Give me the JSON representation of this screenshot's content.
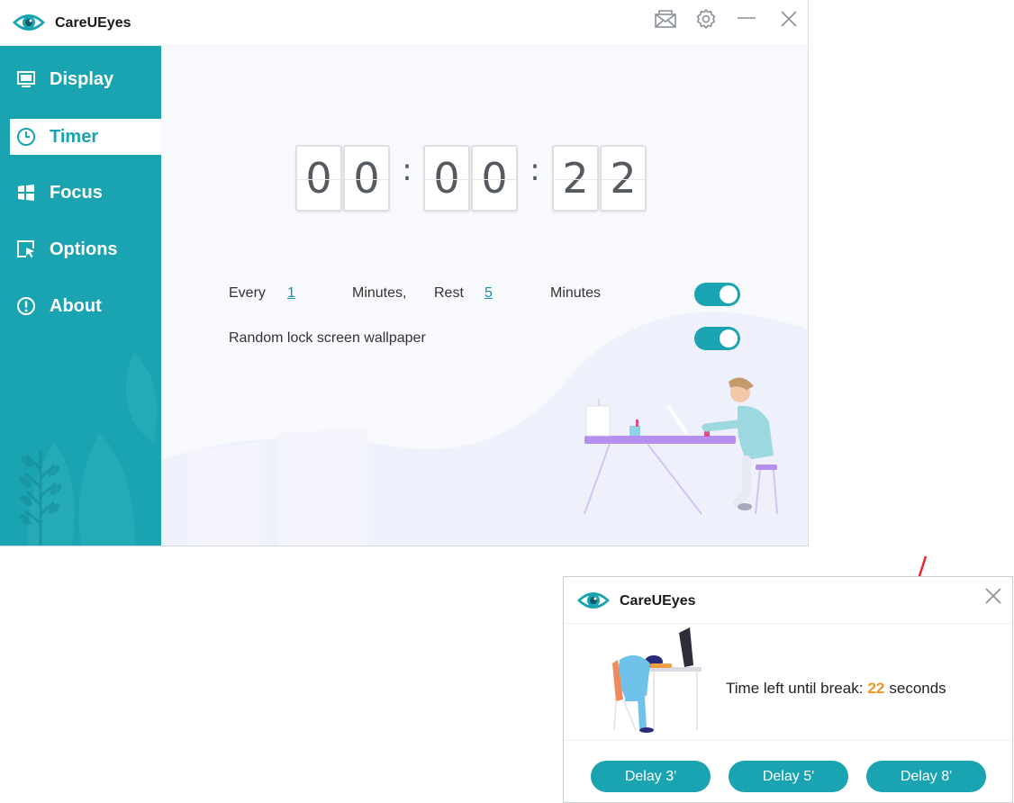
{
  "app": {
    "title": "CareUEyes"
  },
  "colors": {
    "accent": "#1aa3b0",
    "highlight": "#f0931f",
    "arrow": "#e8262b"
  },
  "sidebar": {
    "items": [
      {
        "label": "Display",
        "icon": "monitor-icon",
        "active": false
      },
      {
        "label": "Timer",
        "icon": "clock-icon",
        "active": true
      },
      {
        "label": "Focus",
        "icon": "windows-icon",
        "active": false
      },
      {
        "label": "Options",
        "icon": "cursor-window-icon",
        "active": false
      },
      {
        "label": "About",
        "icon": "info-icon",
        "active": false
      }
    ]
  },
  "timer": {
    "digits": [
      "0",
      "0",
      "0",
      "0",
      "2",
      "2"
    ],
    "separator": ":"
  },
  "settings": {
    "every_label": "Every",
    "every_value": "1",
    "minutes_comma": "Minutes,",
    "rest_label": "Rest",
    "rest_value": "5",
    "minutes_label": "Minutes",
    "break_toggle_on": true,
    "wallpaper_label": "Random lock screen wallpaper",
    "wallpaper_toggle_on": true
  },
  "popup": {
    "title": "CareUEyes",
    "message_prefix": "Time left until break:",
    "seconds_value": "22",
    "message_suffix": "seconds",
    "buttons": [
      "Delay 3'",
      "Delay 5'",
      "Delay 8'"
    ]
  }
}
